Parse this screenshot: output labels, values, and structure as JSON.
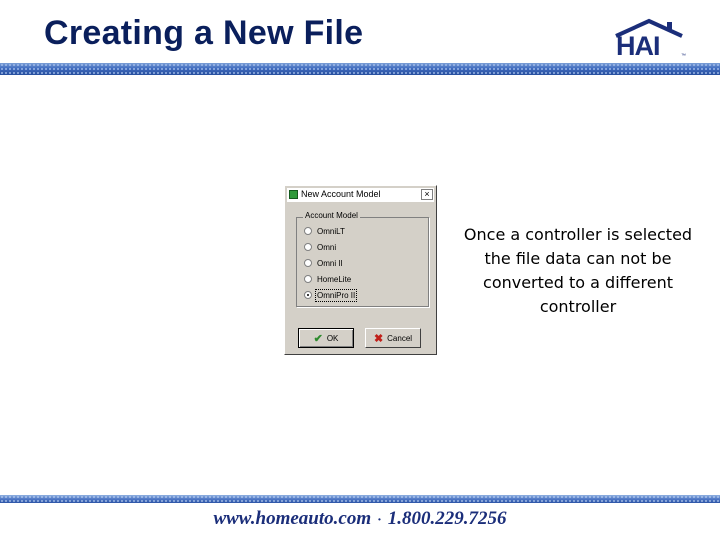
{
  "slide": {
    "title": "Creating a New File",
    "logo_text": "HAI",
    "logo_tm": "™",
    "note": "Once a controller is selected the file data can not be converted to a different controller",
    "footer_website": "www.homeauto.com",
    "footer_separator": "·",
    "footer_phone": "1.800.229.7256"
  },
  "dialog": {
    "title": "New Account Model",
    "close_label": "×",
    "group_label": "Account Model",
    "options": [
      {
        "label": "OmniLT",
        "selected": false
      },
      {
        "label": "Omni",
        "selected": false
      },
      {
        "label": "Omni II",
        "selected": false
      },
      {
        "label": "HomeLite",
        "selected": false
      },
      {
        "label": "OmniPro II",
        "selected": true
      }
    ],
    "ok_label": "OK",
    "cancel_label": "Cancel"
  },
  "colors": {
    "title": "#0a1f5c",
    "accent_bar": "#3f6bbf",
    "dialog_bg": "#d4d0c8"
  },
  "icons": {
    "ok": "check-icon",
    "cancel": "cross-icon",
    "app": "app-icon",
    "logo": "house-roof-logo"
  }
}
